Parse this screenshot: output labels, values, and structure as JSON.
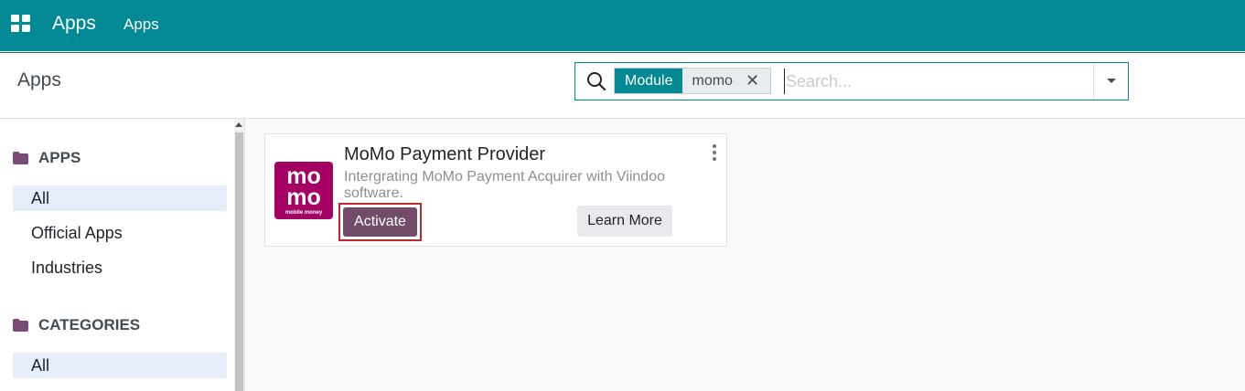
{
  "navbar": {
    "app_menu_icon": "apps-grid-icon",
    "app_name": "Apps",
    "menu_items": [
      {
        "label": "Apps"
      }
    ],
    "bg_color": "#018a95"
  },
  "control_panel": {
    "title": "Apps"
  },
  "search": {
    "icon": "search-icon",
    "facets": [
      {
        "label": "Module",
        "value": "momo",
        "remove_icon": "close-icon"
      }
    ],
    "placeholder": "Search...",
    "value": "",
    "toggle_icon": "caret-down-icon"
  },
  "sidebar": {
    "sections": [
      {
        "header": "APPS",
        "icon": "folder-icon",
        "items": [
          {
            "label": "All",
            "active": true
          },
          {
            "label": "Official Apps",
            "active": false
          },
          {
            "label": "Industries",
            "active": false
          }
        ]
      },
      {
        "header": "CATEGORIES",
        "icon": "folder-icon",
        "items": [
          {
            "label": "All",
            "active": true
          }
        ]
      }
    ]
  },
  "apps": [
    {
      "name": "MoMo Payment Provider",
      "description": "Intergrating MoMo Payment Acquirer with Viindoo software.",
      "logo": {
        "text_lines": [
          "mo",
          "mo"
        ],
        "caption": "mobile money",
        "bg_color": "#a50064"
      },
      "menu_icon": "vertical-dots-icon",
      "primary_action": "Activate",
      "secondary_action": "Learn More"
    }
  ],
  "colors": {
    "primary": "#018a95",
    "activate": "#714b67",
    "highlight_box": "#c0262c"
  }
}
